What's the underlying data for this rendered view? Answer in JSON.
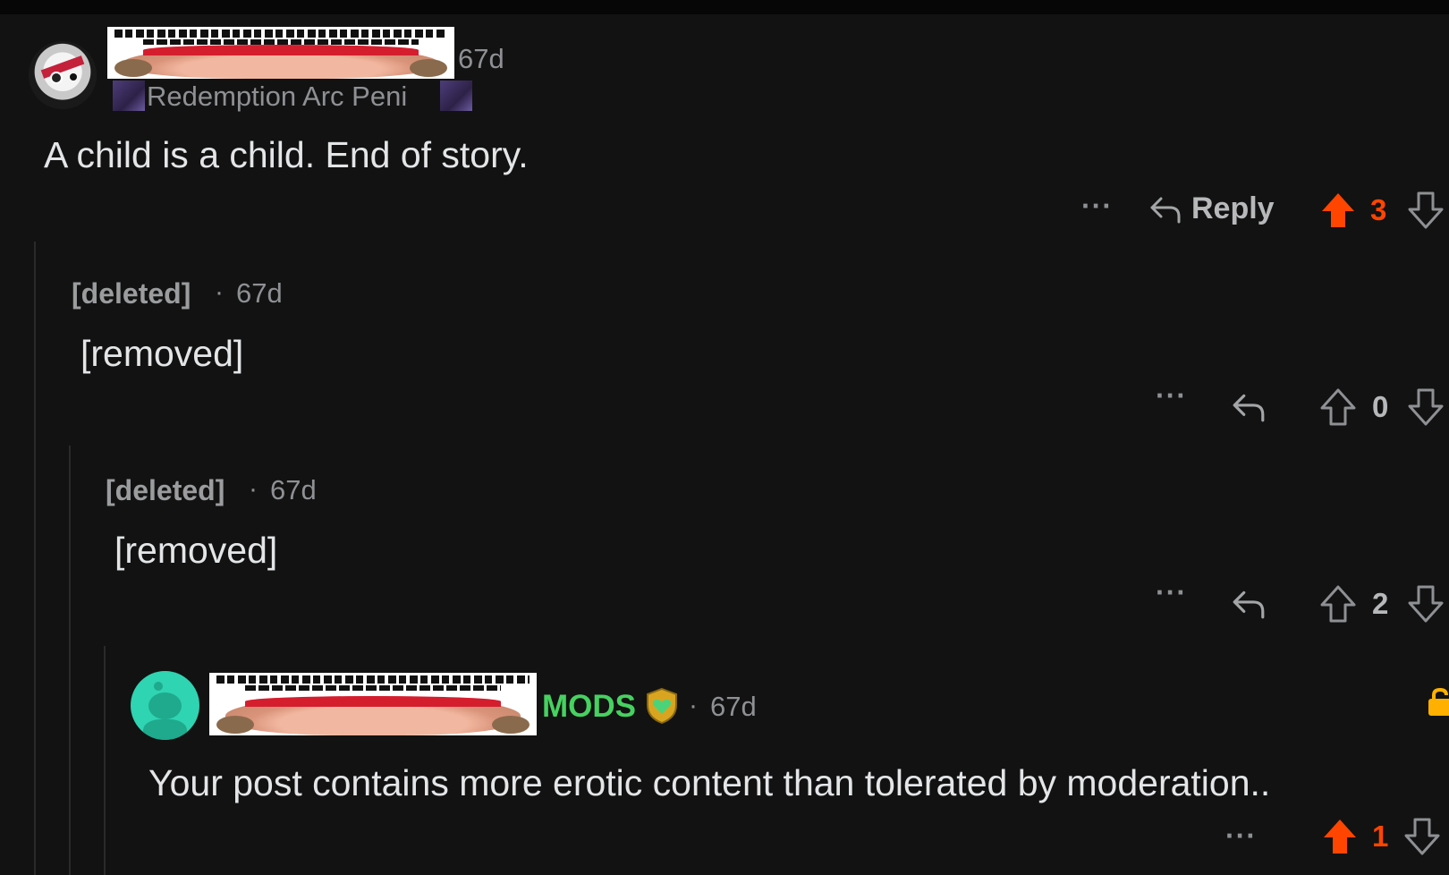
{
  "comments": [
    {
      "time": "67d",
      "flair": "Redemption Arc Peni",
      "body": "A child is a child. End of story.",
      "actions": {
        "more": "···",
        "reply": "Reply",
        "votes": "3",
        "upvoted": true
      }
    },
    {
      "user": "[deleted]",
      "separator": "·",
      "time": "67d",
      "body": "[removed]",
      "actions": {
        "more": "···",
        "votes": "0",
        "upvoted": false
      }
    },
    {
      "user": "[deleted]",
      "separator": "·",
      "time": "67d",
      "body": "[removed]",
      "actions": {
        "more": "···",
        "votes": "2",
        "upvoted": false
      }
    },
    {
      "flair": "MODS",
      "separator": "·",
      "time": "67d",
      "body": "Your post contains more erotic content than tolerated by moderation..",
      "actions": {
        "more": "···",
        "votes": "1",
        "upvoted": true
      }
    }
  ],
  "colors": {
    "background": "#121212",
    "upvote": "#ff4500",
    "mod_green": "#46d160",
    "mod_avatar": "#2fd4b2",
    "lock": "#ffb000"
  },
  "icons": [
    "reply-arrow-icon",
    "upvote-arrow-icon",
    "downvote-arrow-icon",
    "more-dots-icon",
    "shield-icon",
    "lock-icon"
  ]
}
